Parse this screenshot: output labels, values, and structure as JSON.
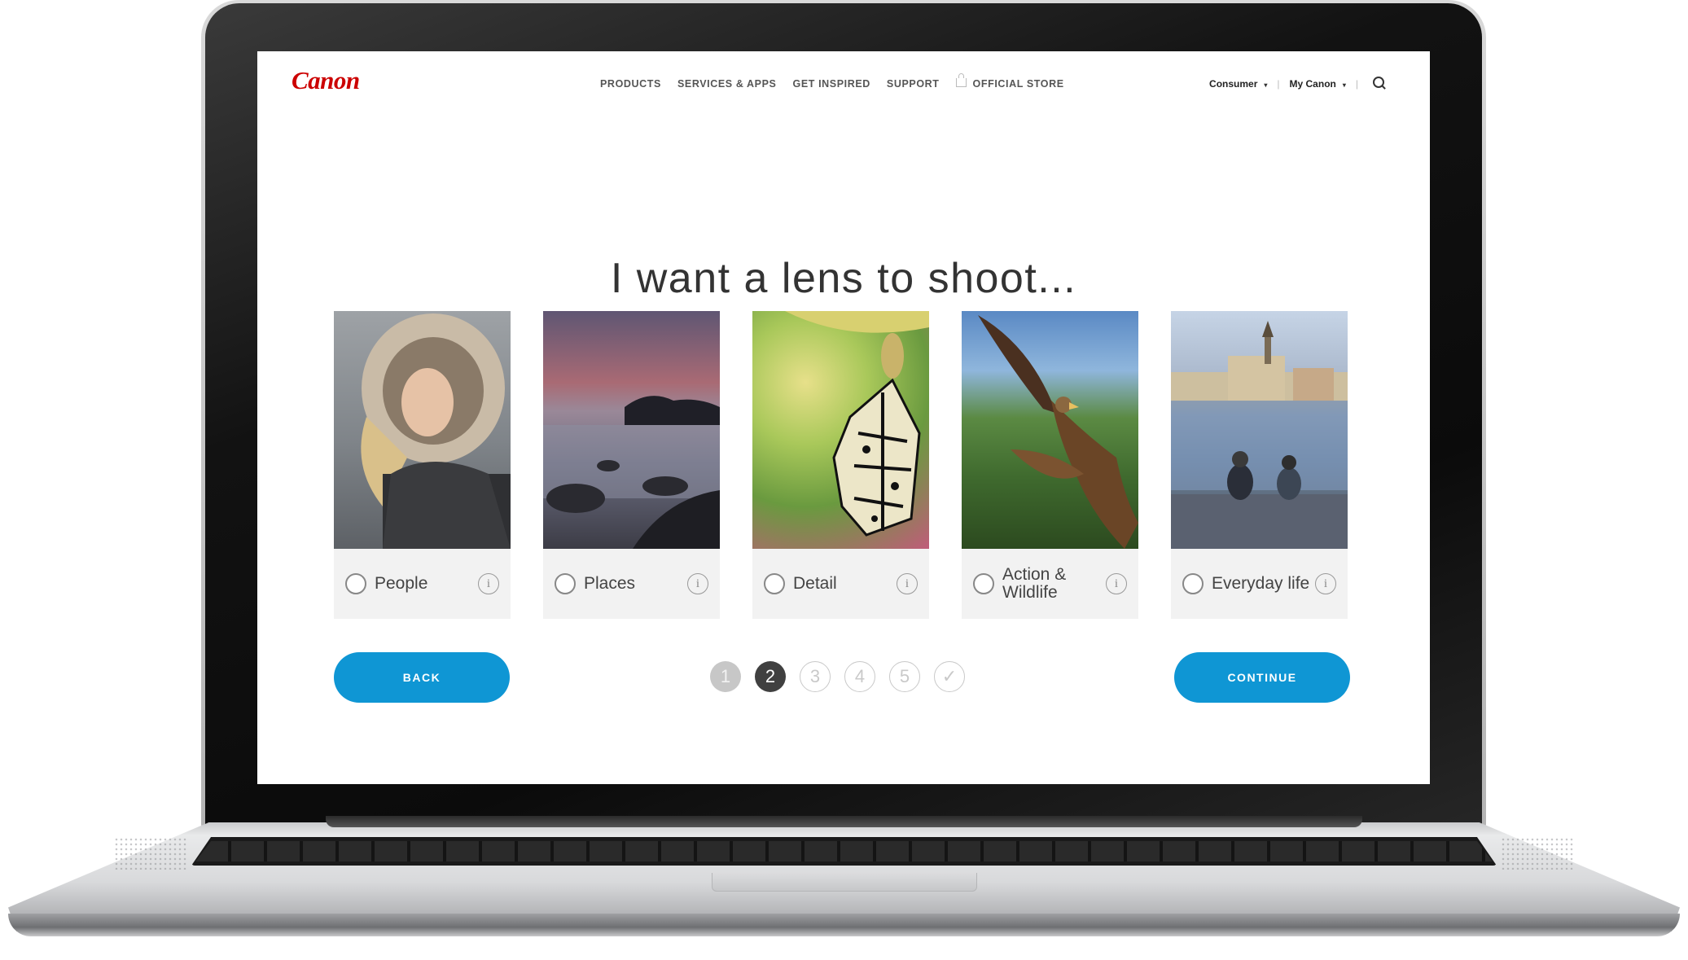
{
  "header": {
    "logo": "Canon",
    "nav": [
      "PRODUCTS",
      "SERVICES & APPS",
      "GET INSPIRED",
      "SUPPORT",
      "OFFICIAL STORE"
    ],
    "account_type": "Consumer",
    "my_account": "My Canon",
    "separator": "|",
    "caret": "▾"
  },
  "main": {
    "title": "I want a lens to shoot...",
    "options": [
      {
        "label": "People",
        "info": "i",
        "image": "portrait of woman in fur hood"
      },
      {
        "label": "Places",
        "info": "i",
        "image": "seascape at dusk with rocks"
      },
      {
        "label": "Detail",
        "info": "i",
        "image": "macro butterfly on chrysalis"
      },
      {
        "label": "Action & Wildlife",
        "info": "i",
        "image": "bird of prey in flight"
      },
      {
        "label": "Everyday life",
        "info": "i",
        "image": "two people sitting by river"
      }
    ],
    "back_label": "BACK",
    "continue_label": "CONTINUE",
    "steps": [
      {
        "label": "1",
        "state": "done"
      },
      {
        "label": "2",
        "state": "current"
      },
      {
        "label": "3",
        "state": "todo"
      },
      {
        "label": "4",
        "state": "todo"
      },
      {
        "label": "5",
        "state": "todo"
      },
      {
        "label": "✓",
        "state": "todo"
      }
    ]
  },
  "colors": {
    "brand_red": "#cc0000",
    "accent_blue": "#0f96d4",
    "step_current": "#404040",
    "step_done": "#c7c7c7"
  }
}
